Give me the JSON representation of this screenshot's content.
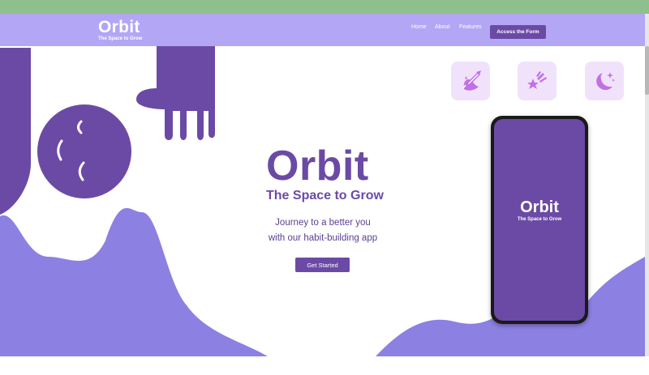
{
  "header": {
    "brand_title": "Orbit",
    "brand_subtitle": "The Space to Grow",
    "nav": [
      "Home",
      "About",
      "Features"
    ],
    "cta_label": "Access the Form"
  },
  "hero": {
    "title": "Orbit",
    "subtitle": "The Space to Grow",
    "description_lines": [
      "Journey to a better you",
      "with our habit-building app"
    ],
    "button_label": "Get Started"
  },
  "features": [
    {
      "icon": "rocket-icon"
    },
    {
      "icon": "shooting-star-icon"
    },
    {
      "icon": "moon-stars-icon"
    }
  ],
  "phone": {
    "title": "Orbit",
    "subtitle": "The Space to Grow"
  },
  "colors": {
    "header_bg": "#b3a6f5",
    "primary": "#6b4aa5",
    "wave": "#8d80e3",
    "tile_bg": "#f1e2fb",
    "icon": "#c270e6"
  }
}
